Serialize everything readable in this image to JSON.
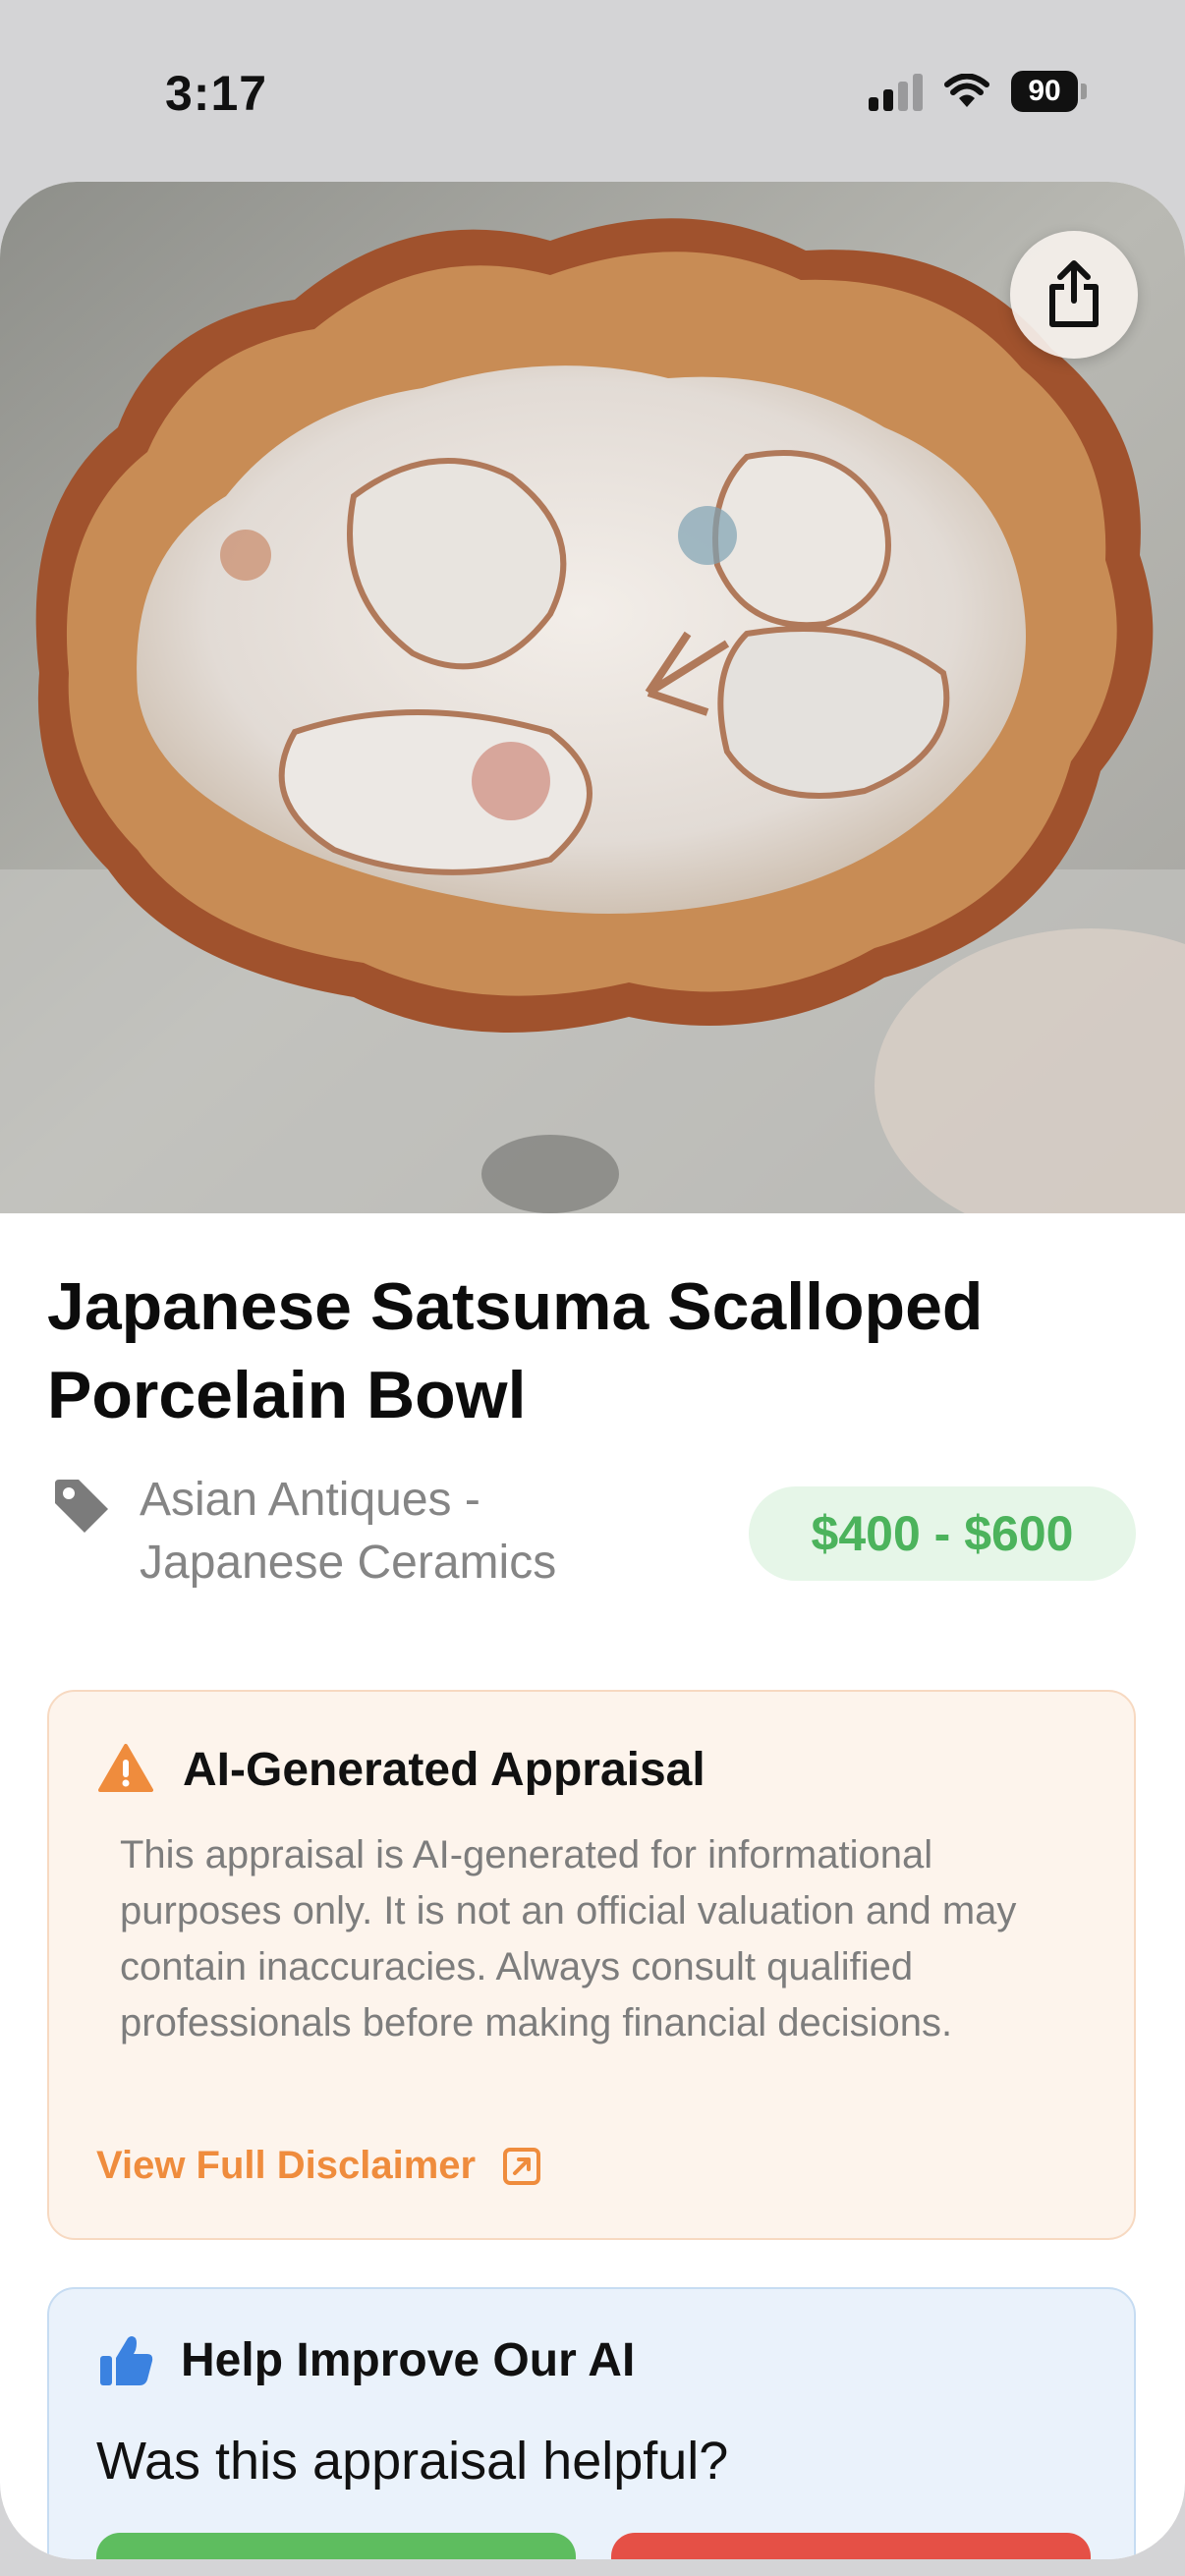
{
  "status_bar": {
    "time": "3:17",
    "battery": "90"
  },
  "item": {
    "title": "Japanese Satsuma Scalloped Porcelain Bowl",
    "category_line1": "Asian Antiques -",
    "category_line2": "Japanese Ceramics",
    "price_range": "$400 - $600"
  },
  "disclaimer": {
    "title": "AI-Generated Appraisal",
    "body": "This appraisal is AI-generated for informational purposes only. It is not an official valuation and may contain inaccuracies. Always consult qualified professionals before making financial decisions.",
    "link_label": "View Full Disclaimer"
  },
  "feedback": {
    "title": "Help Improve Our AI",
    "question": "Was this appraisal helpful?"
  },
  "colors": {
    "accent_orange": "#ef8c3d",
    "price_green": "#4cb35c",
    "yes_green": "#5ebd5f",
    "no_red": "#e55046",
    "thumb_blue": "#3b82e0"
  },
  "icons": {
    "share": "share-icon",
    "tag": "tag-icon",
    "warning": "warning-icon",
    "external_link": "external-link-icon",
    "thumbs_up": "thumbs-up-icon"
  }
}
